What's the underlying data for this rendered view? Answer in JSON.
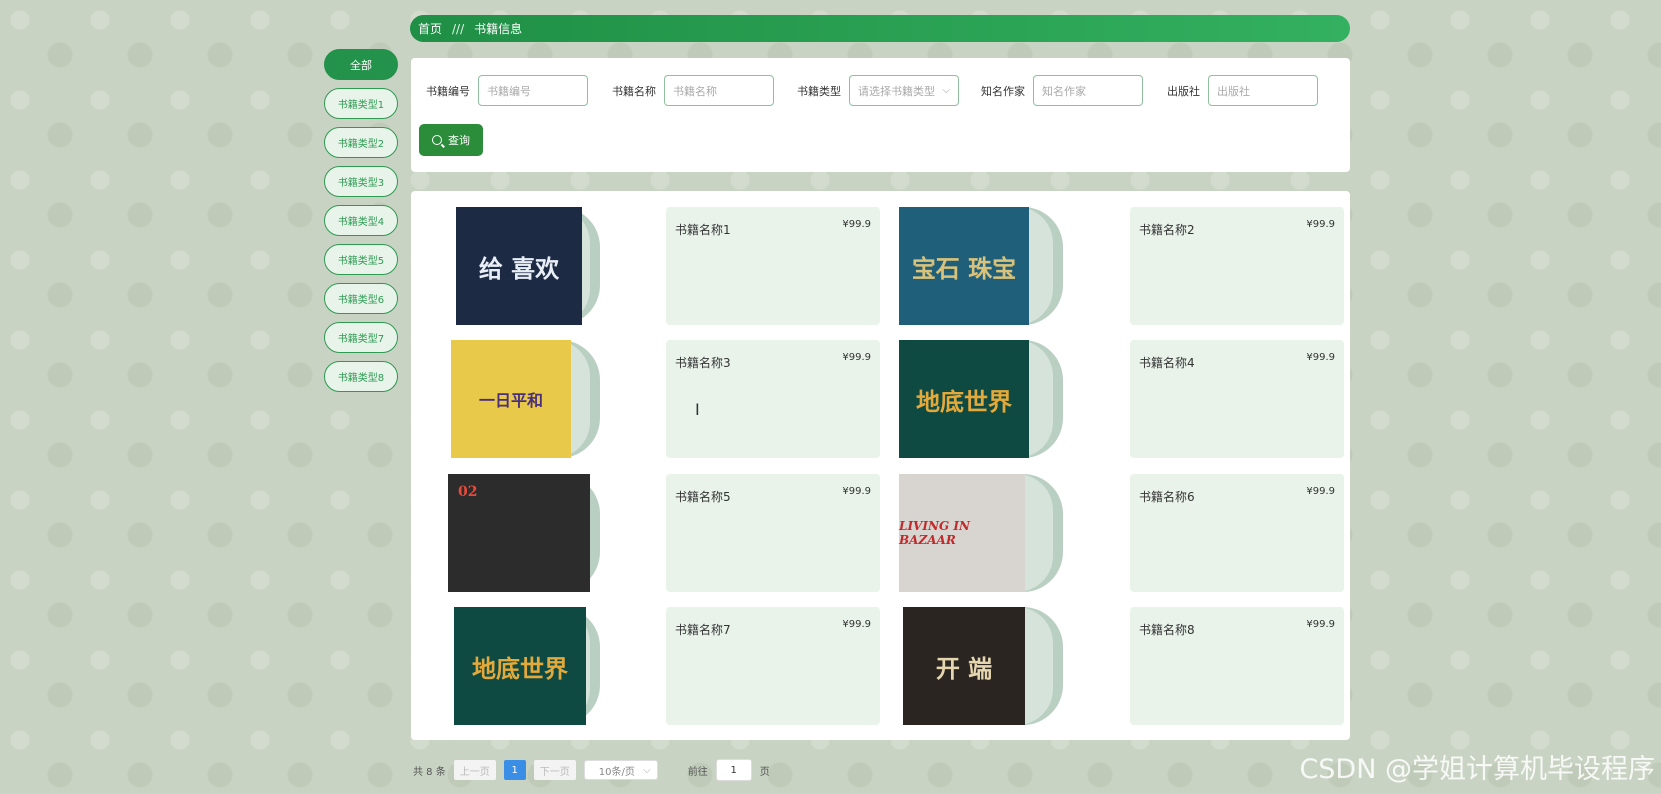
{
  "breadcrumb": {
    "home": "首页",
    "sep": "///",
    "current": "书籍信息"
  },
  "categories": [
    "全部",
    "书籍类型1",
    "书籍类型2",
    "书籍类型3",
    "书籍类型4",
    "书籍类型5",
    "书籍类型6",
    "书籍类型7",
    "书籍类型8"
  ],
  "search": {
    "fields": [
      {
        "label": "书籍编号",
        "placeholder": "书籍编号"
      },
      {
        "label": "书籍名称",
        "placeholder": "书籍名称"
      },
      {
        "label": "书籍类型",
        "placeholder": "请选择书籍类型"
      },
      {
        "label": "知名作家",
        "placeholder": "知名作家"
      },
      {
        "label": "出版社",
        "placeholder": "出版社"
      }
    ],
    "query_label": "查询"
  },
  "books": [
    {
      "name": "书籍名称1",
      "price": "¥99.9",
      "cover_text": "给 喜欢",
      "cover_bg": "#1d2a44",
      "cover_fg": "#e8eef6"
    },
    {
      "name": "书籍名称2",
      "price": "¥99.9",
      "cover_text": "宝石 珠宝",
      "cover_bg": "#1f5f7a",
      "cover_fg": "#d9c27a"
    },
    {
      "name": "书籍名称3",
      "price": "¥99.9",
      "cover_text": "一日平和",
      "cover_bg": "#e9c94a",
      "cover_fg": "#4a2f7a"
    },
    {
      "name": "书籍名称4",
      "price": "¥99.9",
      "cover_text": "地底世界",
      "cover_bg": "#0f4a42",
      "cover_fg": "#e3a93a"
    },
    {
      "name": "书籍名称5",
      "price": "¥99.9",
      "cover_text": "02",
      "cover_bg": "#2c2c2c",
      "cover_fg": "#e84a3a"
    },
    {
      "name": "书籍名称6",
      "price": "¥99.9",
      "cover_text": "LIVING IN BAZAAR",
      "cover_bg": "#d8d4d0",
      "cover_fg": "#c02a2a"
    },
    {
      "name": "书籍名称7",
      "price": "¥99.9",
      "cover_text": "地底世界",
      "cover_bg": "#0f4a42",
      "cover_fg": "#e3a93a"
    },
    {
      "name": "书籍名称8",
      "price": "¥99.9",
      "cover_text": "开 端",
      "cover_bg": "#2a2520",
      "cover_fg": "#e6d6b0"
    }
  ],
  "pagination": {
    "total": "共 8 条",
    "prev": "上一页",
    "current": "1",
    "next": "下一页",
    "page_size": "10条/页",
    "goto_label": "前往",
    "goto_value": "1",
    "page_unit": "页"
  },
  "watermark": "CSDN @学姐计算机毕设程序"
}
